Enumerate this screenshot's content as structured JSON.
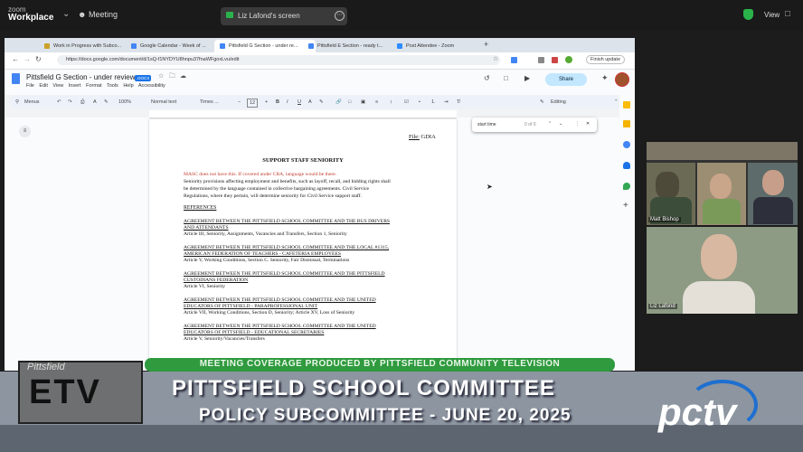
{
  "zoom": {
    "brand_small": "zoom",
    "brand_big": "Workplace",
    "meeting_label": "Meeting",
    "share_label": "Liz Lafond's screen",
    "view_label": "View"
  },
  "browser": {
    "tabs": [
      {
        "label": "Work in Progress with Subco...",
        "active": false,
        "color": "#c9a227"
      },
      {
        "label": "Google Calendar - Week of ...",
        "active": false,
        "color": "#4285f4"
      },
      {
        "label": "Pittsfield G Section - under re...",
        "active": true,
        "color": "#4285f4"
      },
      {
        "label": "Pittsfield E Section - ready t...",
        "active": false,
        "color": "#4285f4"
      },
      {
        "label": "Post Attendee - Zoom",
        "active": false,
        "color": "#2d8cff"
      }
    ],
    "url": "https://docs.google.com/document/d/1sQ-f1NYDYU8hnpu37fnaWFgoxLvu/edit",
    "finish_update": "Finish update"
  },
  "doc": {
    "title": "Pittsfield G Section - under review",
    "badge": ".DOCX",
    "menu": [
      "File",
      "Edit",
      "View",
      "Insert",
      "Format",
      "Tools",
      "Help",
      "Accessibility"
    ],
    "share_label": "Share",
    "editing_label": "Editing",
    "toolbar": {
      "menus": "Menus",
      "zoom": "100%",
      "style": "Normal text",
      "font": "Times ...",
      "size": "12"
    },
    "find": {
      "query": "start time",
      "count": "0 of 0"
    },
    "file_code_label": "File:",
    "file_code": "GDIA",
    "heading": "SUPPORT STAFF SENIORITY",
    "comment": "MASC does not have this. If covered under CBA, language would be there.",
    "para1": "Seniority provisions affecting employment and benefits, such as layoff, recall, and bidding rights shall",
    "para2": "be determined by the language contained in collective bargaining agreements. Civil Service",
    "para3": "Regulations, where they pertain, will determine seniority for Civil Service support staff.",
    "references": "REFERENCES",
    "agreements": [
      {
        "l1": "AGREEMENT BETWEEN THE PITTSFIELD SCHOOL COMMITTEE AND THE BUS DRIVERS",
        "l2": "AND ATTENDANTS",
        "art": "Article III, Seniority, Assignments, Vacancies and Transfers, Section 1, Seniority"
      },
      {
        "l1": "AGREEMENT BETWEEN THE PITTSFIELD SCHOOL COMMITTEE AND THE LOCAL #1315,",
        "l2": "AMERICAN FEDERATION OF TEACHERS - CAFETERIA EMPLOYEES",
        "art": "Article V, Working Conditions, Section C. Seniority, Fair Dismissal, Terminations"
      },
      {
        "l1": "AGREEMENT BETWEEN THE PITTSFIELD SCHOOL COMMITTEE AND THE PITTSFIELD",
        "l2": "CUSTODIANS FEDERATION",
        "art": "Article VI, Seniority"
      },
      {
        "l1": "AGREEMENT BETWEEN THE PITTSFIELD SCHOOL COMMITTEE AND THE UNITED",
        "l2": "EDUCATORS OF PITTSFIELD - PARAPROFESSIONAL UNIT",
        "art": "Article VII, Working Conditions, Section D, Seniority; Article XV, Loss of Seniority"
      },
      {
        "l1": "AGREEMENT BETWEEN THE PITTSFIELD SCHOOL COMMITTEE AND THE UNITED",
        "l2": "EDUCATORS OF PITTSFIELD - EDUCATIONAL SECRETARIES",
        "art": "Article V, Seniority/Vacancies/Transfers"
      }
    ]
  },
  "participants": {
    "p1_name": "Matt Bishop",
    "p2_name": "Liz Lafond"
  },
  "broadcast": {
    "coverage": "MEETING COVERAGE PRODUCED BY PITTSFIELD COMMUNITY TELEVISION",
    "title": "PITTSFIELD SCHOOL COMMITTEE",
    "subtitle": "POLICY SUBCOMMITTEE - JUNE 20, 2025",
    "etv_small": "Pittsfield",
    "etv_big": "ETV",
    "pctv": "pctv"
  }
}
